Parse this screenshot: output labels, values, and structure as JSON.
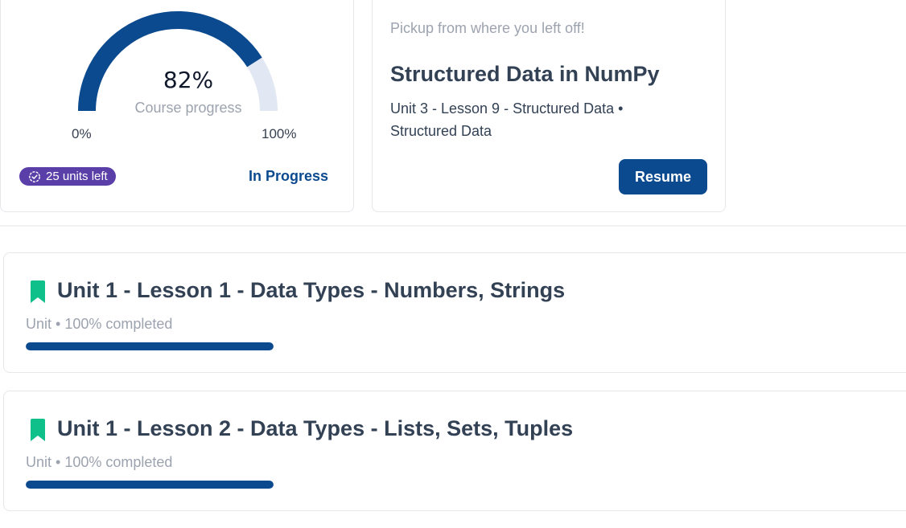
{
  "progress_card": {
    "percent_text": "82%",
    "percent_value": 82,
    "label": "Course progress",
    "min_label": "0%",
    "max_label": "100%",
    "units_left": "25 units left",
    "status": "In Progress",
    "colors": {
      "fill": "#0b4a8f",
      "track": "#e2e8f3",
      "badge": "#5b3fa8"
    }
  },
  "resume_card": {
    "hint": "Pickup from where you left off!",
    "title": "Structured Data in NumPy",
    "subtitle": "Unit 3 - Lesson 9 - Structured Data • Structured Data",
    "button_label": "Resume"
  },
  "lessons": [
    {
      "title": "Unit 1 - Lesson 1 - Data Types - Numbers, Strings",
      "meta": "Unit • 100% completed",
      "progress": 100,
      "icon": "bookmark-icon"
    },
    {
      "title": "Unit 1 - Lesson 2 - Data Types - Lists, Sets, Tuples",
      "meta": "Unit • 100% completed",
      "progress": 100,
      "icon": "bookmark-icon"
    }
  ]
}
